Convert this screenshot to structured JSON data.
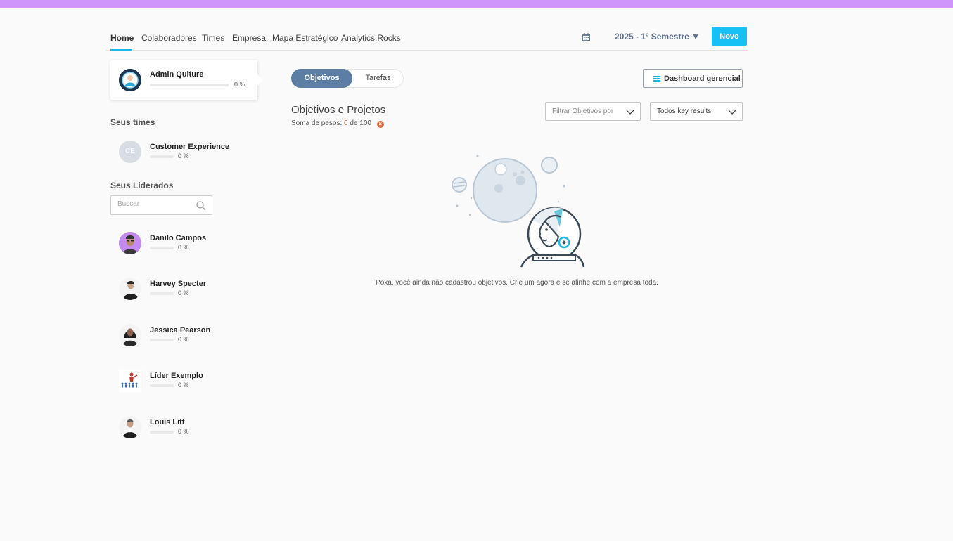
{
  "nav": {
    "tabs": [
      "Home",
      "Colaboradores",
      "Times",
      "Empresa",
      "Mapa Estratégico",
      "Analytics.Rocks"
    ],
    "active_tab": "Home",
    "semester": "2025 - 1º Semestre ▼",
    "new_button": "Novo",
    "calendar_icon": "calendar-icon"
  },
  "sidebar": {
    "current_user": {
      "name": "Admin Qulture",
      "progress": "0 %"
    },
    "teams_title": "Seus times",
    "teams": [
      {
        "initials": "CE",
        "name": "Customer Experience",
        "progress": "0 %"
      }
    ],
    "led_title": "Seus Liderados",
    "search_placeholder": "Buscar",
    "people": [
      {
        "name": "Danilo Campos",
        "progress": "0 %"
      },
      {
        "name": "Harvey Specter",
        "progress": "0 %"
      },
      {
        "name": "Jessica Pearson",
        "progress": "0 %"
      },
      {
        "name": "Líder Exemplo",
        "progress": "0 %"
      },
      {
        "name": "Louis Litt",
        "progress": "0 %"
      }
    ]
  },
  "main": {
    "toggle": {
      "objectives": "Objetivos",
      "tasks": "Tarefas",
      "selected": "Objetivos"
    },
    "dashboard_button": "Dashboard gerencial",
    "title": "Objetivos e Projetos",
    "weights_label": "Soma de pesos:",
    "weights_value": "0",
    "weights_total": "de 100",
    "filter_placeholder": "Filtrar Objetivos por",
    "kr_filter": "Todos key results",
    "empty_message": "Poxa, você ainda não cadastrou objetivos. Crie um agora e se alinhe com a empresa toda."
  },
  "colors": {
    "top_strip": "#cf95f9",
    "accent": "#17c0f5",
    "toggle_active": "#5c7ea5",
    "semester_text": "#5a6f8a"
  }
}
